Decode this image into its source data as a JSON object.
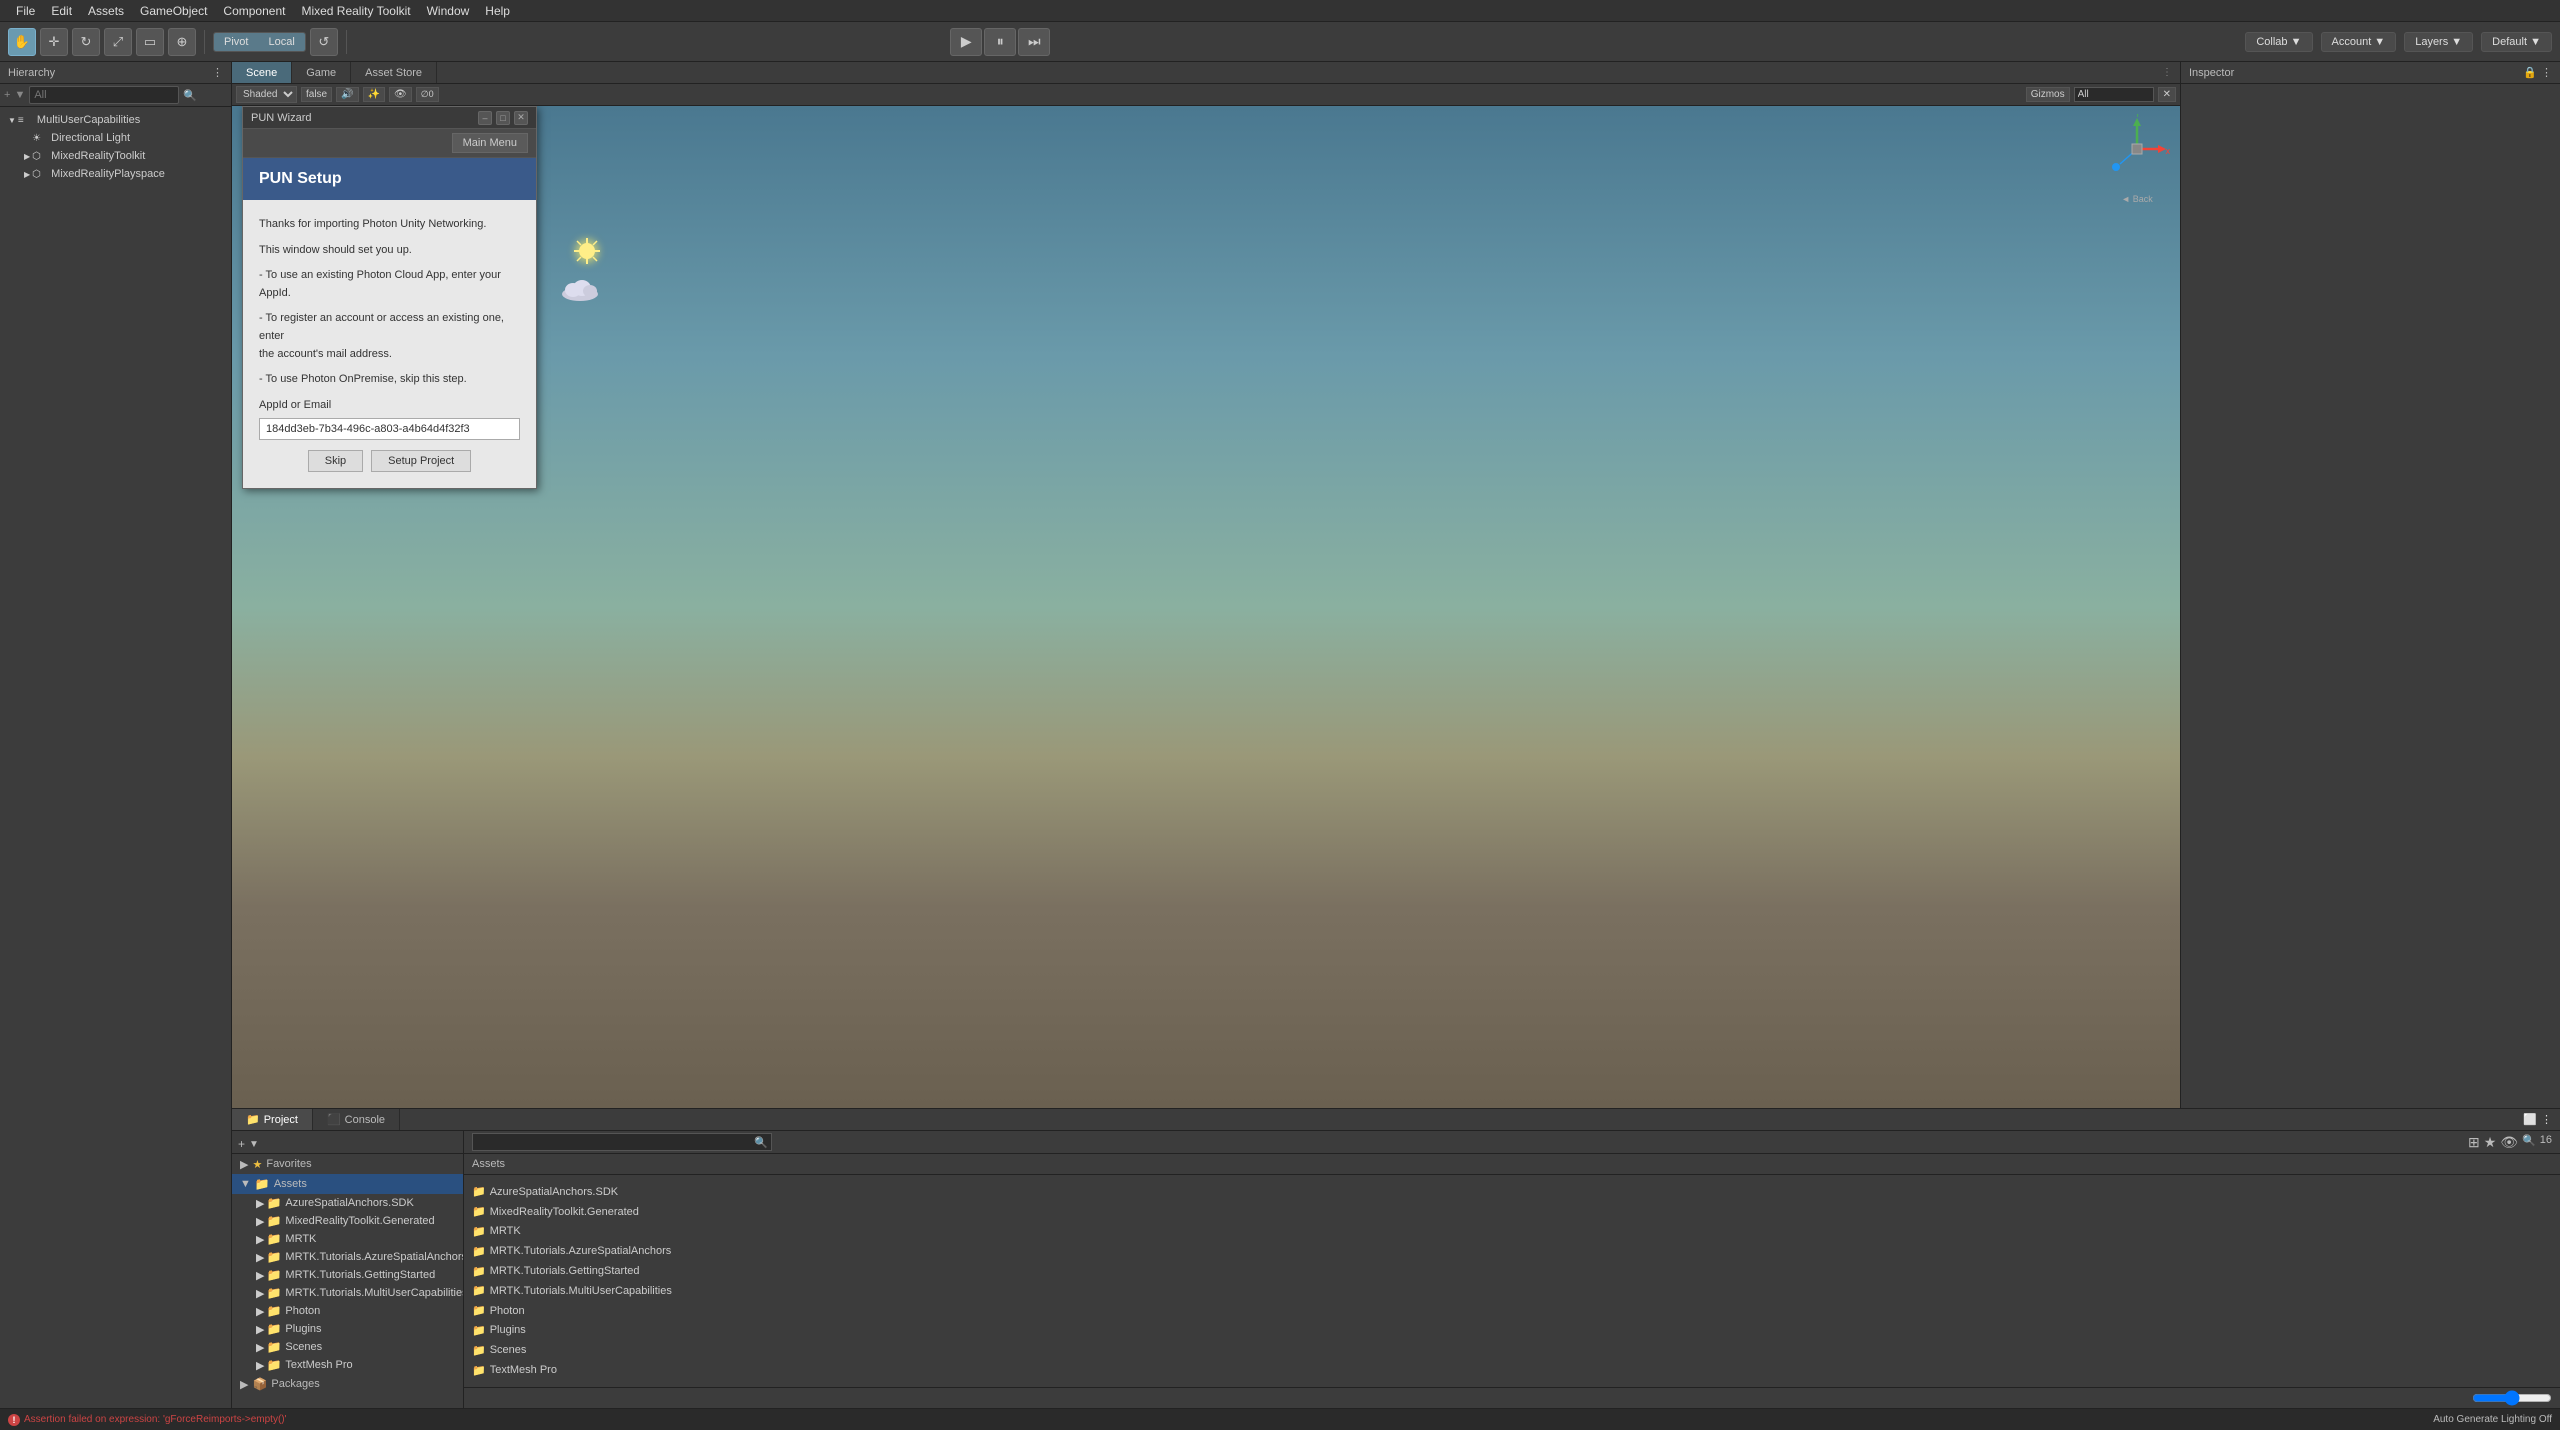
{
  "menubar": {
    "items": [
      "File",
      "Edit",
      "Assets",
      "GameObject",
      "Component",
      "Mixed Reality Toolkit",
      "Window",
      "Help"
    ]
  },
  "toolbar": {
    "tools": [
      "hand",
      "move",
      "rotate",
      "scale",
      "rect",
      "multi"
    ],
    "pivot_label": "Pivot",
    "local_label": "Local",
    "refresh_icon": "↺",
    "play_icon": "▶",
    "pause_icon": "⏸",
    "step_icon": "⏭",
    "collab_label": "Collab ▼",
    "account_label": "Account ▼",
    "layers_label": "Layers ▼",
    "default_label": "Default ▼"
  },
  "hierarchy": {
    "title": "Hierarchy",
    "search_placeholder": "All",
    "tree": [
      {
        "indent": 0,
        "arrow": "▼",
        "label": "MultiUserCapabilities",
        "type": "scene"
      },
      {
        "indent": 1,
        "arrow": "",
        "label": "Directional Light",
        "type": "light"
      },
      {
        "indent": 1,
        "arrow": "▶",
        "label": "MixedRealityToolkit",
        "type": "object"
      },
      {
        "indent": 1,
        "arrow": "▶",
        "label": "MixedRealityPlayspace",
        "type": "object"
      }
    ]
  },
  "scene": {
    "tabs": [
      "Scene",
      "Game",
      "Asset Store"
    ],
    "active_tab": "Scene",
    "shading_mode": "Shaded",
    "is_2d": false,
    "gizmos_label": "Gizmos",
    "all_label": "All",
    "back_label": "◄ Back"
  },
  "pun_wizard": {
    "title": "PUN Wizard",
    "main_menu_btn": "Main Menu",
    "setup_title": "PUN Setup",
    "description_line1": "Thanks for importing Photon Unity Networking.",
    "description_line2": "This window should set you up.",
    "bullet1": "- To use an existing Photon Cloud App, enter your AppId.",
    "bullet2": "- To register an account or access an existing one, enter",
    "bullet2b": "the account's mail address.",
    "bullet3": "- To use Photon OnPremise, skip this step.",
    "field_label": "AppId or Email",
    "field_value": "184dd3eb-7b34-496c-a803-a4b64d4f32f3",
    "skip_btn": "Skip",
    "setup_btn": "Setup Project"
  },
  "inspector": {
    "title": "Inspector",
    "lock_icon": "🔒"
  },
  "project": {
    "tab_project": "Project",
    "tab_console": "Console",
    "assets_header": "Assets",
    "search_placeholder": "",
    "sidebar_tree": [
      {
        "indent": 0,
        "label": "Favorites",
        "icon": "★",
        "arrow": "▶"
      },
      {
        "indent": 0,
        "label": "Assets",
        "icon": "📁",
        "arrow": "▼",
        "selected": true
      },
      {
        "indent": 1,
        "label": "AzureSpatialAnchors.SDK",
        "icon": "📁",
        "arrow": "▶"
      },
      {
        "indent": 1,
        "label": "MixedRealityToolkit.Generated",
        "icon": "📁",
        "arrow": "▶"
      },
      {
        "indent": 1,
        "label": "MRTK",
        "icon": "📁",
        "arrow": "▶"
      },
      {
        "indent": 1,
        "label": "MRTK.Tutorials.AzureSpatialAnchors",
        "icon": "📁",
        "arrow": "▶"
      },
      {
        "indent": 1,
        "label": "MRTK.Tutorials.GettingStarted",
        "icon": "📁",
        "arrow": "▶"
      },
      {
        "indent": 1,
        "label": "MRTK.Tutorials.MultiUserCapabilities",
        "icon": "📁",
        "arrow": "▶"
      },
      {
        "indent": 1,
        "label": "Photon",
        "icon": "📁",
        "arrow": "▶"
      },
      {
        "indent": 1,
        "label": "Plugins",
        "icon": "📁",
        "arrow": "▶"
      },
      {
        "indent": 1,
        "label": "Scenes",
        "icon": "📁",
        "arrow": "▶"
      },
      {
        "indent": 1,
        "label": "TextMesh Pro",
        "icon": "📁",
        "arrow": "▶"
      },
      {
        "indent": 0,
        "label": "Packages",
        "icon": "📦",
        "arrow": "▶"
      }
    ],
    "main_folders": [
      "AzureSpatialAnchors.SDK",
      "MixedRealityToolkit.Generated",
      "MRTK",
      "MRTK.Tutorials.AzureSpatialAnchors",
      "MRTK.Tutorials.GettingStarted",
      "MRTK.Tutorials.MultiUserCapabilities",
      "Photon",
      "Plugins",
      "Scenes",
      "TextMesh Pro"
    ],
    "zoom_value": "16"
  },
  "statusbar": {
    "error_text": "Assertion failed on expression: 'gForceReimports->empty()'",
    "right_text": "Auto Generate Lighting Off"
  }
}
